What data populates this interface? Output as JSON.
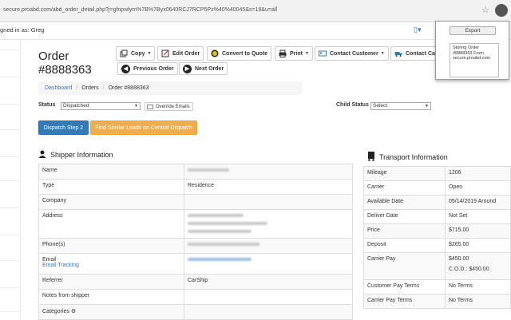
{
  "browser": {
    "url": "secure.proabd.com/abd_order_detail.php?j=gfnpwlym%7B%7Byx0640RCJ7RCP5Pz%40%40045&s=18&u=all"
  },
  "topbar": {
    "signed_in": "gned in as: Greg"
  },
  "order": {
    "title_line1": "Order",
    "title_line2": "#8888363"
  },
  "toolbar": {
    "copy": "Copy",
    "edit": "Edit Order",
    "quote": "Convert to Quote",
    "print": "Print",
    "contact_customer": "Contact Customer",
    "contact_carrier": "Contact Ca",
    "previous": "Previous Order",
    "next": "Next Order"
  },
  "breadcrumb": {
    "dashboard": "Dashboard",
    "orders": "Orders",
    "current": "Order #8888363"
  },
  "status": {
    "label": "Status",
    "value": "Dispatched",
    "override": "Override Emails",
    "child_label": "Child Status",
    "child_value": "Select"
  },
  "actions": {
    "dispatch": "Dispatch Step 2",
    "find_similar": "Find Similar Loads on Central Dispatch"
  },
  "shipper": {
    "heading": "Shipper Information",
    "rows": [
      {
        "k": "Name",
        "v": ""
      },
      {
        "k": "Type",
        "v": "Residence"
      },
      {
        "k": "Company",
        "v": ""
      },
      {
        "k": "Address",
        "v": ""
      },
      {
        "k": "Phone(s)",
        "v": ""
      },
      {
        "k": "Email",
        "v": "",
        "link": "Email Tracking"
      },
      {
        "k": "Referrer",
        "v": "CarShip"
      },
      {
        "k": "Notes from shipper",
        "v": ""
      },
      {
        "k": "Categories",
        "v": ""
      }
    ]
  },
  "transport": {
    "heading": "Transport Information",
    "rows": [
      {
        "k": "Mileage",
        "v": "1206"
      },
      {
        "k": "Carrier",
        "v": "Open"
      },
      {
        "k": "Available Date",
        "v": "05/14/2019 Around"
      },
      {
        "k": "Deliver Date",
        "v": "Not Set"
      },
      {
        "k": "Price",
        "v": "$715.00"
      },
      {
        "k": "Deposit",
        "v": "$265.00"
      },
      {
        "k": "Carrier Pay",
        "v": "$450.00",
        "v2": "C.O.D.: $450.00"
      },
      {
        "k": "Customer Pay Terms",
        "v": "No Terms"
      },
      {
        "k": "Carrier Pay Terms",
        "v": "No Terms"
      }
    ]
  },
  "popup": {
    "button": "Export",
    "message": "Storing Order #8888363 From secure.proabd.com"
  },
  "colors": {
    "primary": "#337ab7",
    "orange": "#f0ad4e"
  }
}
